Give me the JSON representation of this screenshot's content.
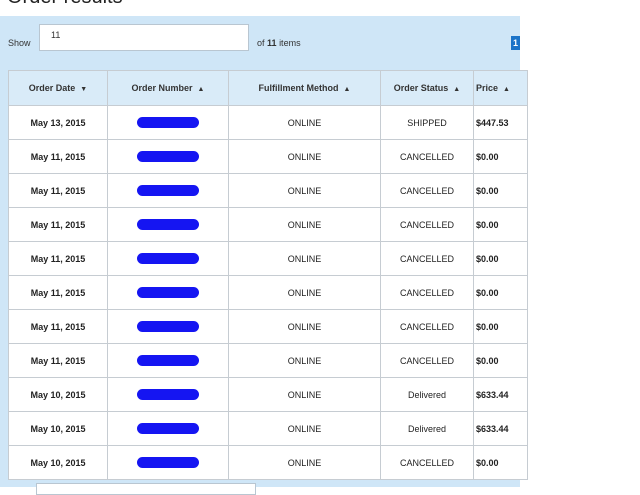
{
  "title": "Order results",
  "toolbar": {
    "show_label": "Show",
    "show_value": "11",
    "of_prefix": "of",
    "total_count": "11",
    "items_suffix": "items",
    "page_current": "1"
  },
  "table": {
    "columns": [
      {
        "label": "Order Date",
        "sort": "▼"
      },
      {
        "label": "Order Number",
        "sort": "▲"
      },
      {
        "label": "Fulfillment Method",
        "sort": "▲"
      },
      {
        "label": "Order Status",
        "sort": "▲"
      },
      {
        "label": "Price",
        "sort": "▲"
      }
    ],
    "rows": [
      {
        "date": "May 13, 2015",
        "method": "ONLINE",
        "status": "SHIPPED",
        "price": "$447.53"
      },
      {
        "date": "May 11, 2015",
        "method": "ONLINE",
        "status": "CANCELLED",
        "price": "$0.00"
      },
      {
        "date": "May 11, 2015",
        "method": "ONLINE",
        "status": "CANCELLED",
        "price": "$0.00"
      },
      {
        "date": "May 11, 2015",
        "method": "ONLINE",
        "status": "CANCELLED",
        "price": "$0.00"
      },
      {
        "date": "May 11, 2015",
        "method": "ONLINE",
        "status": "CANCELLED",
        "price": "$0.00"
      },
      {
        "date": "May 11, 2015",
        "method": "ONLINE",
        "status": "CANCELLED",
        "price": "$0.00"
      },
      {
        "date": "May 11, 2015",
        "method": "ONLINE",
        "status": "CANCELLED",
        "price": "$0.00"
      },
      {
        "date": "May 11, 2015",
        "method": "ONLINE",
        "status": "CANCELLED",
        "price": "$0.00"
      },
      {
        "date": "May 10, 2015",
        "method": "ONLINE",
        "status": "Delivered",
        "price": "$633.44"
      },
      {
        "date": "May 10, 2015",
        "method": "ONLINE",
        "status": "Delivered",
        "price": "$633.44"
      },
      {
        "date": "May 10, 2015",
        "method": "ONLINE",
        "status": "CANCELLED",
        "price": "$0.00"
      }
    ]
  },
  "colors": {
    "panel_bg": "#cfe6f7",
    "header_bg": "#d9ebf8",
    "redaction": "#1515f2",
    "page_button": "#1a73c8"
  }
}
